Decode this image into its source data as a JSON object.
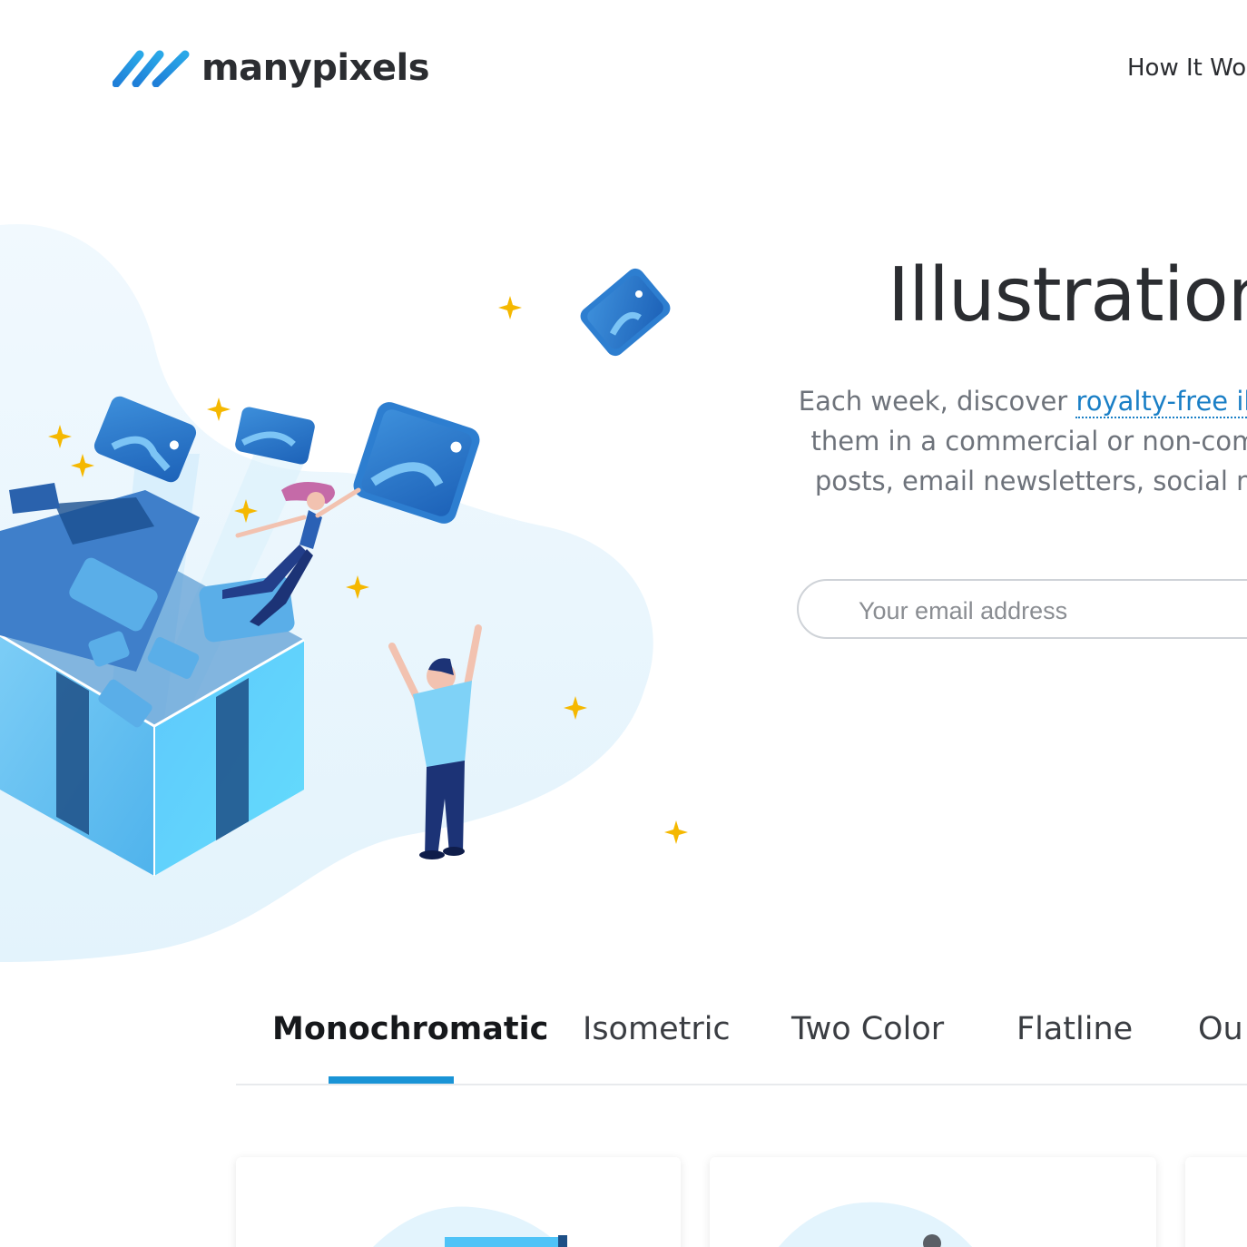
{
  "header": {
    "brand": "manypixels",
    "nav": {
      "how_it_works": "How It Wo"
    }
  },
  "hero": {
    "title": "Illustration",
    "description": {
      "line1_prefix": "Each week, discover ",
      "line1_link": "royalty-free illustratio",
      "line2": "them in a commercial or non-commercia",
      "line3": "posts, email newsletters, social media g"
    },
    "email_placeholder": "Your email address"
  },
  "tabs": {
    "items": [
      {
        "label": "Monochromatic",
        "active": true
      },
      {
        "label": "Isometric",
        "active": false
      },
      {
        "label": "Two Color",
        "active": false
      },
      {
        "label": "Flatline",
        "active": false
      },
      {
        "label": "Ou",
        "active": false
      }
    ]
  },
  "colors": {
    "accent": "#1a94d6",
    "link": "#1a7fc6",
    "text_dark": "#2b2d31",
    "text_muted": "#6e737b",
    "sparkle": "#f5b800"
  }
}
